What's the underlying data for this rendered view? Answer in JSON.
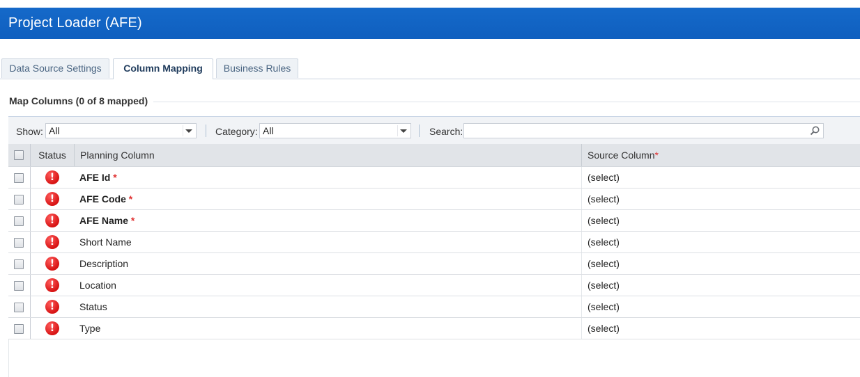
{
  "window": {
    "title": "Project Loader (AFE)"
  },
  "tabs": [
    {
      "label": "Data Source Settings",
      "active": false
    },
    {
      "label": "Column Mapping",
      "active": true
    },
    {
      "label": "Business Rules",
      "active": false
    }
  ],
  "section": {
    "title": "Map Columns (0 of 8 mapped)"
  },
  "filters": {
    "show_label": "Show:",
    "show_value": "All",
    "category_label": "Category:",
    "category_value": "All",
    "search_label": "Search:",
    "search_value": ""
  },
  "grid": {
    "headers": {
      "status": "Status",
      "planning": "Planning Column",
      "source": "Source Column",
      "source_required": "*"
    },
    "rows": [
      {
        "planning": "AFE Id",
        "required": "*",
        "source": "(select)",
        "status_icon": "!"
      },
      {
        "planning": "AFE Code",
        "required": "*",
        "source": "(select)",
        "status_icon": "!"
      },
      {
        "planning": "AFE Name",
        "required": "*",
        "source": "(select)",
        "status_icon": "!"
      },
      {
        "planning": "Short Name",
        "required": "",
        "source": "(select)",
        "status_icon": "!"
      },
      {
        "planning": "Description",
        "required": "",
        "source": "(select)",
        "status_icon": "!"
      },
      {
        "planning": "Location",
        "required": "",
        "source": "(select)",
        "status_icon": "!"
      },
      {
        "planning": "Status",
        "required": "",
        "source": "(select)",
        "status_icon": "!"
      },
      {
        "planning": "Type",
        "required": "",
        "source": "(select)",
        "status_icon": "!"
      }
    ]
  },
  "colors": {
    "title_bar": "#1569c9",
    "error": "#d71414",
    "required": "#e03030"
  }
}
